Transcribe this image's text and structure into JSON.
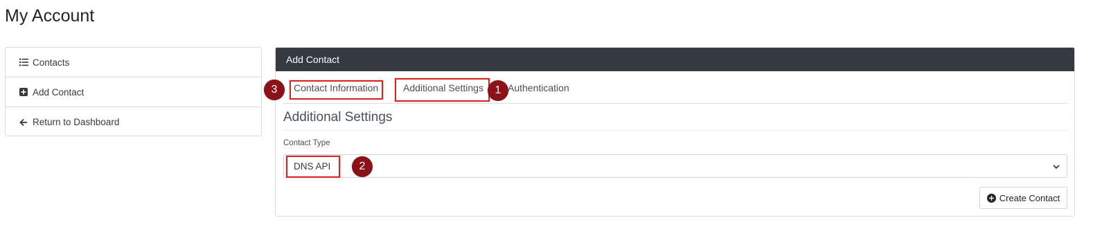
{
  "page": {
    "title": "My Account"
  },
  "sidebar": {
    "items": [
      {
        "label": "Contacts",
        "icon": "list-icon"
      },
      {
        "label": "Add Contact",
        "icon": "plus-square-icon"
      },
      {
        "label": "Return to Dashboard",
        "icon": "arrow-left-icon"
      }
    ]
  },
  "card": {
    "header": "Add Contact",
    "tabs": [
      {
        "label": "Contact Information"
      },
      {
        "label": "Additional Settings",
        "active": true
      },
      {
        "label": "Authentication"
      }
    ],
    "section_title": "Additional Settings",
    "contact_type": {
      "label": "Contact Type",
      "value": "DNS API"
    },
    "create_button": {
      "label": "Create Contact",
      "icon": "plus-circle-icon"
    }
  },
  "annotations": {
    "badges": [
      "1",
      "2",
      "3"
    ],
    "highlight_color": "#e02020",
    "badge_color": "#8b1218"
  },
  "colors": {
    "header_bg": "#343a40",
    "border": "#dcdcdc"
  }
}
